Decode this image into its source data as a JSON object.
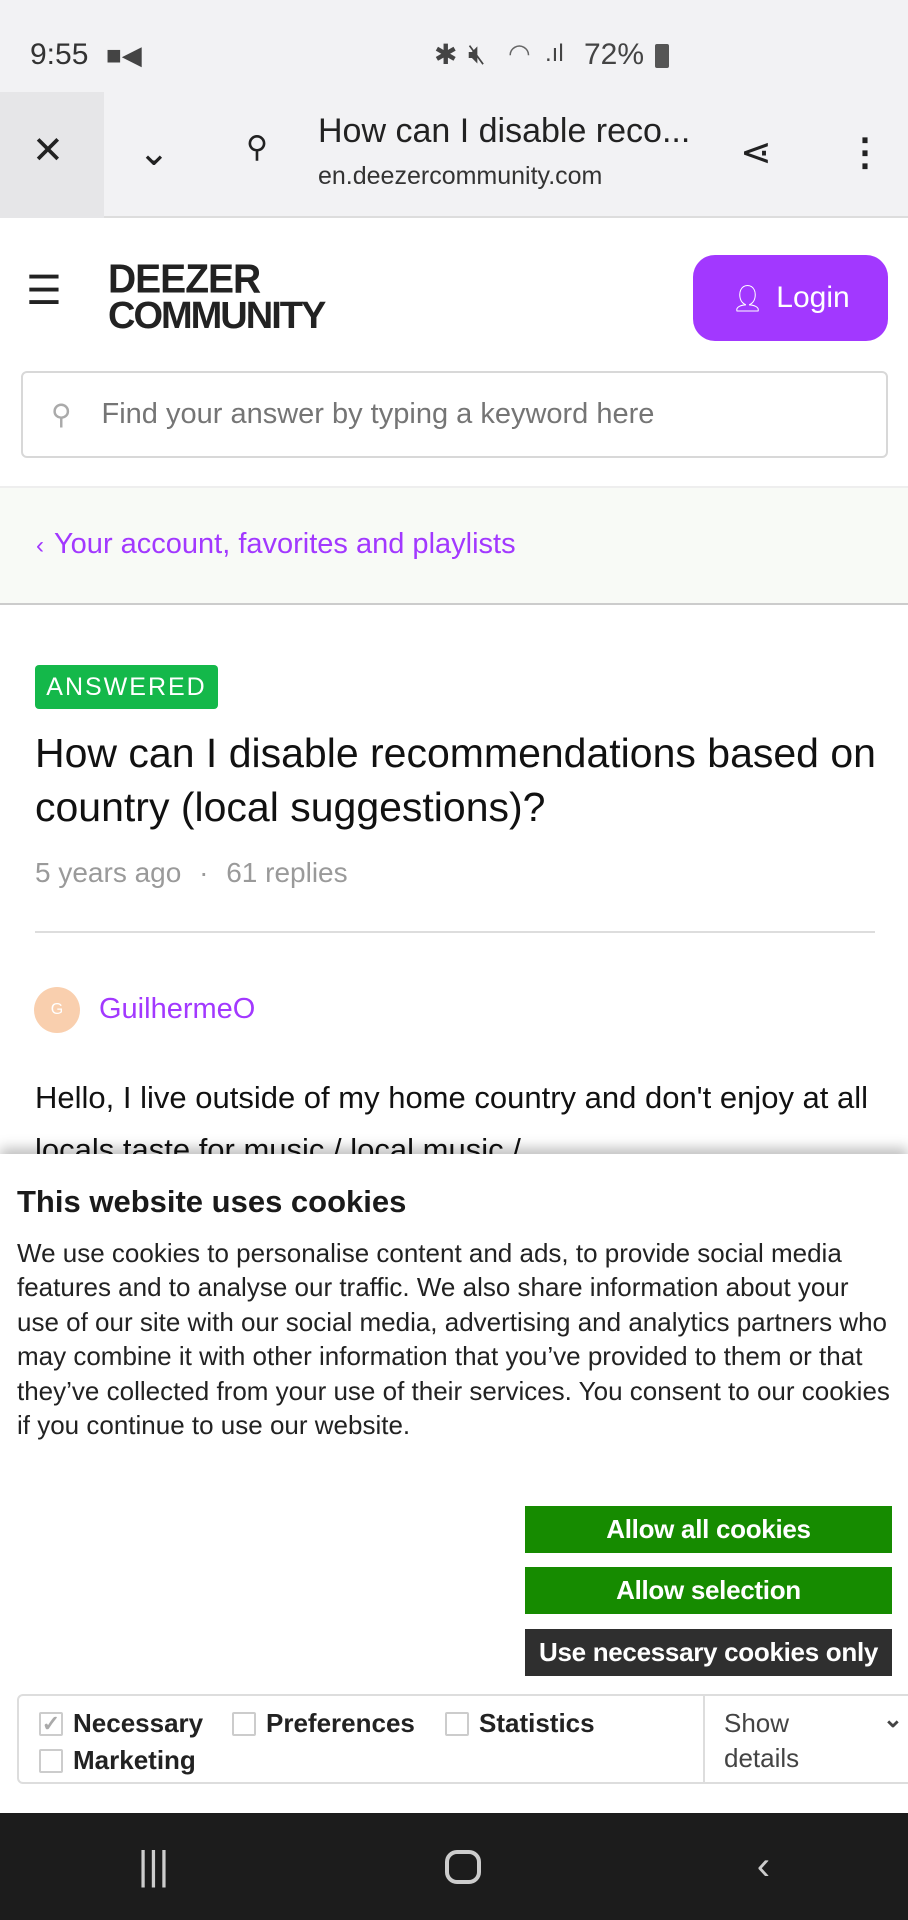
{
  "status_bar": {
    "time": "9:55",
    "battery": "72%",
    "icons": [
      "video-record-icon",
      "bluetooth-icon",
      "mute-icon",
      "wifi-icon",
      "signal-icon",
      "battery-icon"
    ]
  },
  "browser": {
    "page_title": "How can I disable reco...",
    "url": "en.deezercommunity.com"
  },
  "header": {
    "logo_line1": "DEEZER",
    "logo_line2": "COMMUNITY",
    "login_label": "Login"
  },
  "search": {
    "placeholder": "Find your answer by typing a keyword here"
  },
  "breadcrumb": {
    "label": "Your account, favorites and playlists"
  },
  "post": {
    "badge": "ANSWERED",
    "title": "How can I disable recommendations based on country (local suggestions)?",
    "age": "5 years ago",
    "separator": "·",
    "replies": "61 replies",
    "author_initial": "G",
    "author": "GuilhermeO",
    "body": "Hello, I live outside of my home country and don't enjoy at all locals taste for music / local music /"
  },
  "cookie": {
    "title": "This website uses cookies",
    "text": "We use cookies to personalise content and ads, to provide social media features and to analyse our traffic. We also share information about your use of our site with our social media, advertising and analytics partners who may combine it with other information that you’ve provided to them or that they’ve collected from your use of their services. You consent to our cookies if you continue to use our website.",
    "allow_all": "Allow all cookies",
    "allow_selection": "Allow selection",
    "necessary_only": "Use necessary cookies only",
    "options": [
      {
        "label": "Necessary",
        "checked": true
      },
      {
        "label": "Preferences",
        "checked": false
      },
      {
        "label": "Statistics",
        "checked": false
      },
      {
        "label": "Marketing",
        "checked": false
      }
    ],
    "show_details": "Show details"
  },
  "colors": {
    "accent": "#a238ff",
    "answered": "#14b84a",
    "cookie_green": "#168b00",
    "cookie_dark": "#2f2f2f"
  }
}
